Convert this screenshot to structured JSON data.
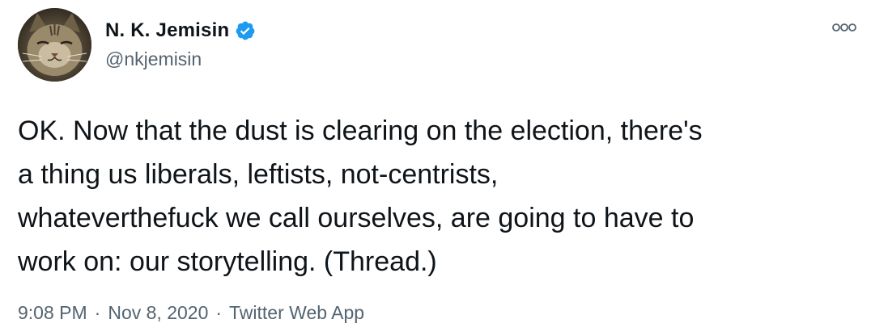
{
  "author": {
    "display_name": "N. K. Jemisin",
    "handle": "@nkjemisin",
    "verified": true,
    "avatar_icon": "cat-avatar"
  },
  "tweet": {
    "text": "OK. Now that the dust is clearing on the election, there's\na thing us liberals, leftists, not-centrists,\nwhateverthefuck we call ourselves, are going to have to\nwork on: our storytelling. (Thread.)"
  },
  "meta": {
    "time": "9:08 PM",
    "separator": "·",
    "date": "Nov 8, 2020",
    "source": "Twitter Web App"
  },
  "icons": {
    "more": "more-options-icon",
    "verified": "verified-badge-icon"
  },
  "colors": {
    "text": "#0f1419",
    "secondary": "#536471",
    "verified": "#1d9bf0"
  }
}
